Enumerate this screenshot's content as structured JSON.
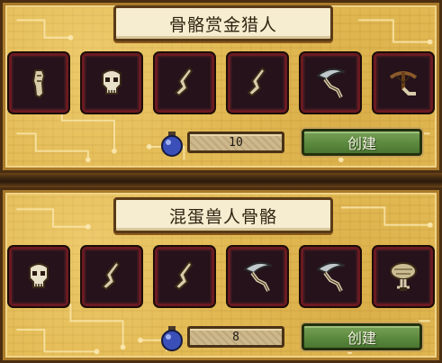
{
  "recipes": [
    {
      "title": "骨骼赏金猎人",
      "ingredients": [
        "bone-key-icon",
        "skull-icon",
        "bone-leg-icon",
        "bone-leg-icon",
        "scythe-arm-icon",
        "crossbow-arm-icon"
      ],
      "cost": "10",
      "create_label": "创建"
    },
    {
      "title": "混蛋兽人骨骼",
      "ingredients": [
        "skull-icon",
        "bone-leg-icon",
        "bone-leg-icon",
        "scythe-arm-icon",
        "scythe-arm-icon",
        "ornate-skull-icon"
      ],
      "cost": "8",
      "create_label": "创建"
    }
  ],
  "colors": {
    "panel": "#e3bb55",
    "slot_bg": "#25121a",
    "slot_border": "#6b1a22",
    "button": "#5b8a3e",
    "orb": "#3b4fb8"
  }
}
